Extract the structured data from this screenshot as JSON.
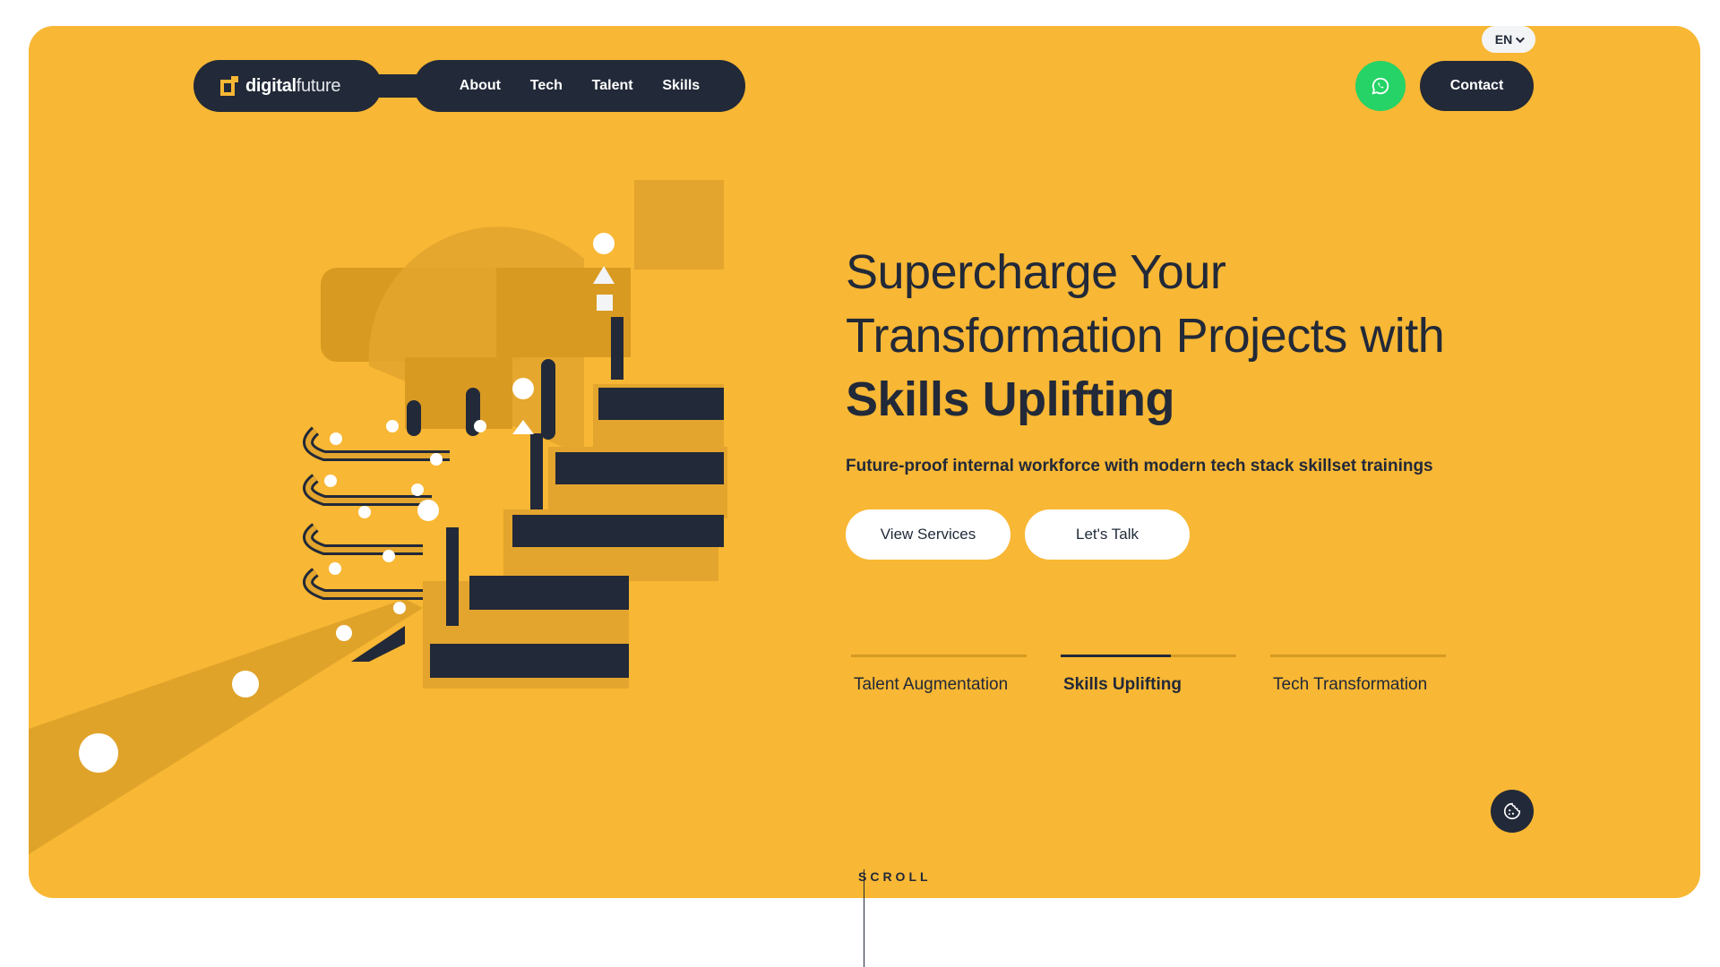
{
  "brand": {
    "logo_bold": "digital",
    "logo_light": "future"
  },
  "nav": {
    "links": [
      "About",
      "Tech",
      "Talent",
      "Skills"
    ]
  },
  "language": {
    "current": "EN"
  },
  "header": {
    "contact_label": "Contact",
    "whatsapp_icon": "whatsapp-icon"
  },
  "hero": {
    "headline_line1": "Supercharge Your",
    "headline_line2": "Transformation Projects with",
    "headline_line3": "Skills Uplifting",
    "subline": "Future-proof internal workforce with modern tech stack skillset trainings",
    "primary_button": "View Services",
    "secondary_button": "Let's Talk"
  },
  "tabs": [
    {
      "label": "Talent Augmentation",
      "progress": 0
    },
    {
      "label": "Skills Uplifting",
      "progress": 0.63
    },
    {
      "label": "Tech Transformation",
      "progress": 0
    }
  ],
  "scroll_label": "SCROLL",
  "colors": {
    "background": "#f8b734",
    "dark": "#222938",
    "whatsapp": "#25d366",
    "accent_dark": "#d59a22"
  },
  "icons": {
    "cookie": "cookie-icon",
    "chevron": "chevron-down-icon"
  }
}
